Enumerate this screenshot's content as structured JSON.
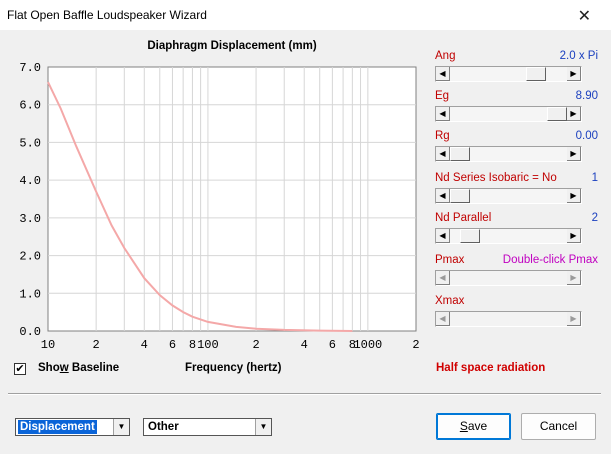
{
  "window": {
    "title": "Flat Open Baffle Loudspeaker Wizard",
    "close_glyph": "✕"
  },
  "chart": {
    "title": "Diaphragm Displacement (mm)"
  },
  "chart_data": {
    "type": "line",
    "title": "Diaphragm Displacement (mm)",
    "xlabel": "Frequency (hertz)",
    "ylabel": "",
    "x_scale": "log",
    "xlim": [
      10,
      2000
    ],
    "ylim": [
      0,
      7
    ],
    "grid": true,
    "y_ticks": [
      "0.0",
      "1.0",
      "2.0",
      "3.0",
      "4.0",
      "5.0",
      "6.0",
      "7.0"
    ],
    "x_tick_labels": [
      {
        "value": 10,
        "label": "10"
      },
      {
        "value": 20,
        "label": "2"
      },
      {
        "value": 40,
        "label": "4"
      },
      {
        "value": 60,
        "label": "6"
      },
      {
        "value": 80,
        "label": "8"
      },
      {
        "value": 100,
        "label": "100"
      },
      {
        "value": 200,
        "label": "2"
      },
      {
        "value": 400,
        "label": "4"
      },
      {
        "value": 600,
        "label": "6"
      },
      {
        "value": 800,
        "label": "8"
      },
      {
        "value": 1000,
        "label": "1000"
      },
      {
        "value": 2000,
        "label": "2"
      }
    ],
    "series": [
      {
        "color": "#f4a8a8",
        "x": [
          10,
          12,
          15,
          20,
          25,
          30,
          40,
          50,
          60,
          70,
          80,
          100,
          150,
          200,
          300,
          500,
          800
        ],
        "y": [
          6.6,
          5.9,
          4.9,
          3.7,
          2.8,
          2.2,
          1.4,
          0.95,
          0.68,
          0.5,
          0.38,
          0.24,
          0.11,
          0.06,
          0.03,
          0.01,
          0.0
        ]
      }
    ]
  },
  "controls": [
    {
      "key": "ang",
      "label": "Ang",
      "value": "2.0 x Pi",
      "value_color": "blue",
      "level": 0.78,
      "enabled": true
    },
    {
      "key": "eg",
      "label": "Eg",
      "value": "8.90",
      "value_color": "blue",
      "level": 1.0,
      "enabled": true
    },
    {
      "key": "rg",
      "label": "Rg",
      "value": "0.00",
      "value_color": "blue",
      "level": 0.0,
      "enabled": true
    },
    {
      "key": "nd_series",
      "label": "Nd Series    Isobaric = No",
      "value": "1",
      "value_color": "blue",
      "level": 0.0,
      "enabled": true
    },
    {
      "key": "nd_parallel",
      "label": "Nd  Parallel",
      "value": "2",
      "value_color": "blue",
      "level": 0.1,
      "enabled": true
    },
    {
      "key": "pmax",
      "label": "Pmax",
      "value": "Double-click Pmax",
      "value_color": "magenta",
      "level": null,
      "enabled": false
    },
    {
      "key": "xmax",
      "label": "Xmax",
      "value": "",
      "value_color": "blue",
      "level": null,
      "enabled": false
    }
  ],
  "show_baseline": {
    "label_before": "Sho",
    "label_underlined": "w",
    "label_after": " Baseline",
    "checked": true,
    "check_glyph": "✔"
  },
  "frequency_label": "Frequency (hertz)",
  "half_space_label": "Half space radiation",
  "selects": {
    "mode": {
      "value": "Displacement"
    },
    "other": {
      "value": "Other"
    }
  },
  "buttons": {
    "save": {
      "label_underlined": "S",
      "label_rest": "ave"
    },
    "cancel": {
      "label": "Cancel"
    }
  },
  "glyphs": {
    "left": "◀",
    "right": "▶",
    "down": "▼"
  }
}
